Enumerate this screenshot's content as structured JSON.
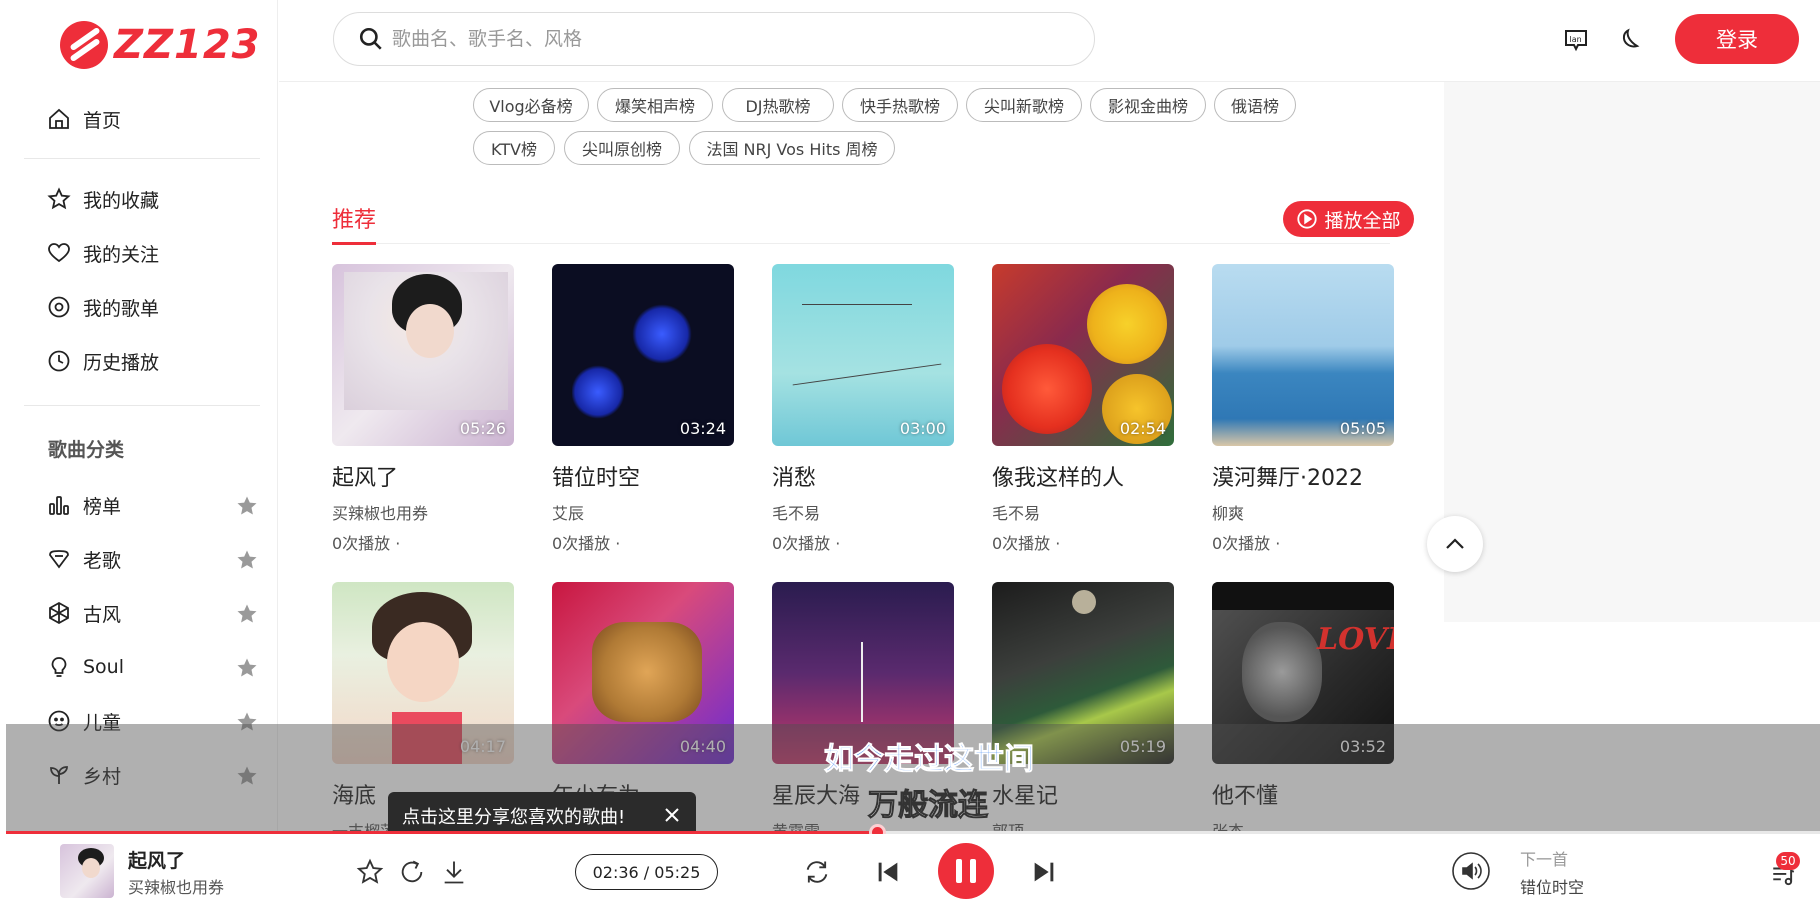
{
  "brand": {
    "logo_text": "ZZ123"
  },
  "sidebar": {
    "home": "首页",
    "favorites": "我的收藏",
    "following": "我的关注",
    "playlists": "我的歌单",
    "history": "历史播放",
    "section_title": "歌曲分类",
    "categories": [
      {
        "label": "榜单",
        "icon": "bar-chart-icon"
      },
      {
        "label": "老歌",
        "icon": "vinyl-tag-icon"
      },
      {
        "label": "古风",
        "icon": "jade-icon"
      },
      {
        "label": "Soul",
        "icon": "bulb-icon"
      },
      {
        "label": "儿童",
        "icon": "child-face-icon"
      },
      {
        "label": "乡村",
        "icon": "plant-icon"
      }
    ]
  },
  "header": {
    "search_placeholder": "歌曲名、歌手名、风格",
    "login_label": "登录"
  },
  "tags": [
    "Vlog必备榜",
    "爆笑相声榜",
    "DJ热歌榜",
    "快手热歌榜",
    "尖叫新歌榜",
    "影视金曲榜",
    "俄语榜",
    "KTV榜",
    "尖叫原创榜",
    "法国 NRJ Vos Hits 周榜"
  ],
  "recommend": {
    "tab_label": "推荐",
    "play_all_label": "播放全部",
    "songs": [
      {
        "title": "起风了",
        "artist": "买辣椒也用券",
        "plays": "0次播放 ·",
        "duration": "05:26",
        "color": "#d7c3dc"
      },
      {
        "title": "错位时空",
        "artist": "艾辰",
        "plays": "0次播放 ·",
        "duration": "03:24",
        "color": "#0b0d22"
      },
      {
        "title": "消愁",
        "artist": "毛不易",
        "plays": "0次播放 ·",
        "duration": "03:00",
        "color": "#7ed4da"
      },
      {
        "title": "像我这样的人",
        "artist": "毛不易",
        "plays": "0次播放 ·",
        "duration": "02:54",
        "color": "#e04a2e"
      },
      {
        "title": "漠河舞厅·2022",
        "artist": "柳爽",
        "plays": "0次播放 ·",
        "duration": "05:05",
        "color": "#8ec3e6"
      },
      {
        "title": "海底",
        "artist": "一支榴莲",
        "plays": "",
        "duration": "04:17",
        "color": "#cfe6c3"
      },
      {
        "title": "年少有为",
        "artist": "",
        "plays": "",
        "duration": "04:40",
        "color": "#c8163f"
      },
      {
        "title": "星辰大海",
        "artist": "黄霄雲",
        "plays": "",
        "duration": "",
        "color": "#5a2a6e"
      },
      {
        "title": "水星记",
        "artist": "郭顶",
        "plays": "",
        "duration": "05:19",
        "color": "#2a2f2c"
      },
      {
        "title": "他不懂",
        "artist": "张杰",
        "plays": "",
        "duration": "03:52",
        "color": "#3c3c3c"
      }
    ]
  },
  "lyrics": {
    "line1": "如今走过这世间",
    "line2": "万般流连"
  },
  "share_tip": {
    "text": "点击这里分享您喜欢的歌曲!"
  },
  "player": {
    "title": "起风了",
    "artist": "买辣椒也用券",
    "time": "02:36 / 05:25",
    "progress": 0.48,
    "next_label": "下一首",
    "next_song": "错位时空",
    "queue_count": "50"
  },
  "colors": {
    "accent": "#ee2e3a"
  }
}
